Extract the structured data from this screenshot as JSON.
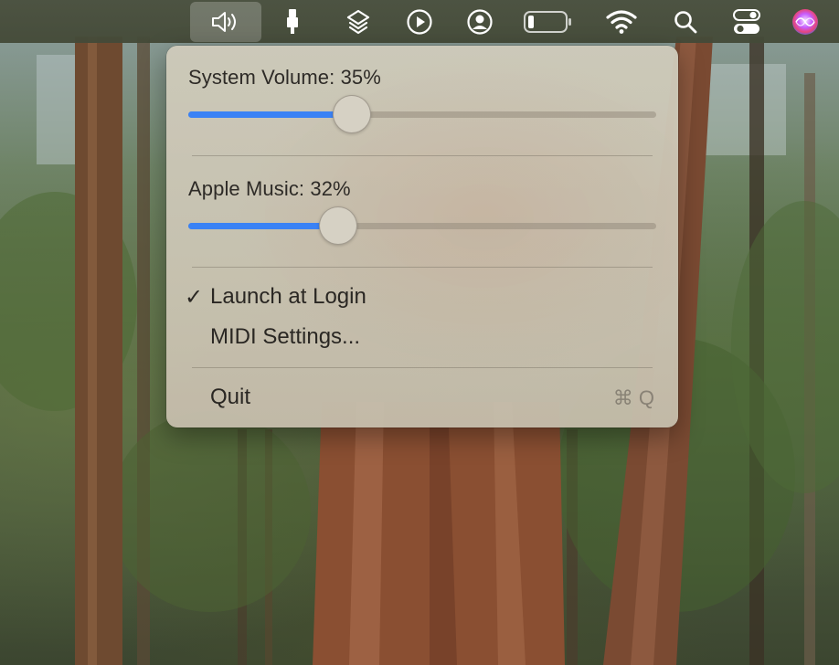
{
  "menubar": {
    "items": [
      {
        "icon": "speaker-volume-icon",
        "active": true
      },
      {
        "icon": "usb-plug-icon"
      },
      {
        "icon": "shortcuts-layers-icon"
      },
      {
        "icon": "play-circle-icon"
      },
      {
        "icon": "user-account-icon"
      },
      {
        "icon": "battery-icon"
      },
      {
        "icon": "wifi-icon"
      },
      {
        "icon": "spotlight-search-icon"
      },
      {
        "icon": "control-center-icon"
      },
      {
        "icon": "siri-icon"
      }
    ]
  },
  "panel": {
    "system_volume": {
      "label": "System Volume: 35%",
      "value": 0.35
    },
    "apple_music": {
      "label": "Apple Music: 32%",
      "value": 0.32
    },
    "menu": {
      "launch_at_login": {
        "check": "✓",
        "label": "Launch at Login",
        "checked": true
      },
      "midi_settings": {
        "label": "MIDI Settings..."
      },
      "quit": {
        "label": "Quit",
        "shortcut": "⌘ Q"
      }
    }
  },
  "colors": {
    "accent": "#3a82f5",
    "menubar": "#4a503e"
  }
}
